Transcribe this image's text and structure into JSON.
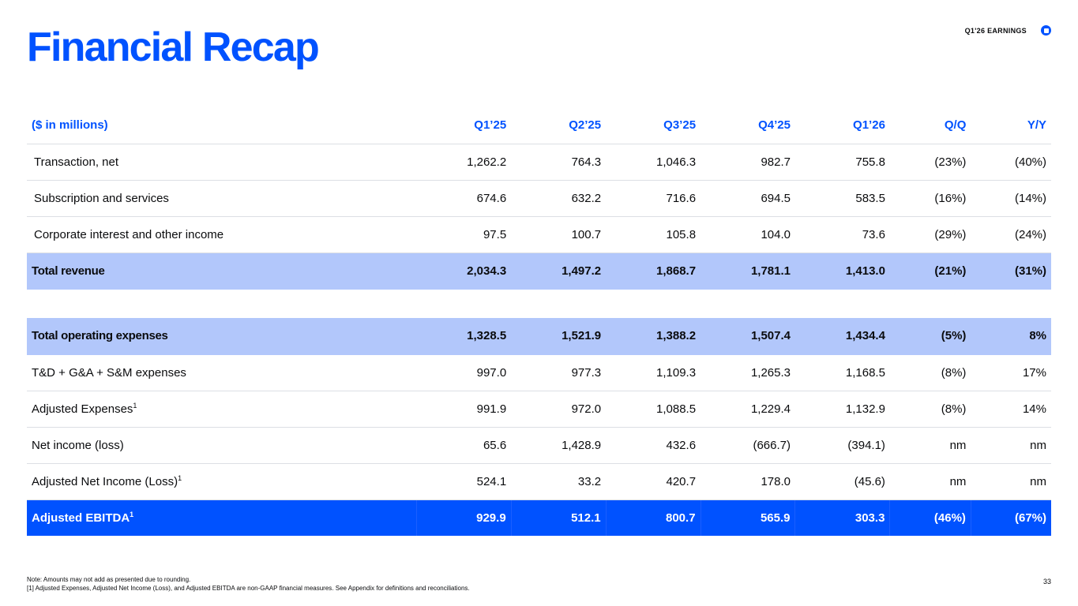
{
  "header": {
    "title": "Financial Recap",
    "earnings_label": "Q1'26 EARNINGS",
    "logo_icon": "coinbase-logo-icon",
    "accent_color": "#0052ff"
  },
  "table": {
    "columns": [
      "($ in millions)",
      "Q1’25",
      "Q2’25",
      "Q3’25",
      "Q4’25",
      "Q1’26",
      "Q/Q",
      "Y/Y"
    ],
    "revenue_rows": [
      {
        "label": "Transaction, net",
        "values": [
          "1,262.2",
          "764.3",
          "1,046.3",
          "982.7",
          "755.8",
          "(23%)",
          "(40%)"
        ]
      },
      {
        "label": "Subscription and services",
        "values": [
          "674.6",
          "632.2",
          "716.6",
          "694.5",
          "583.5",
          "(16%)",
          "(14%)"
        ]
      },
      {
        "label": "Corporate interest and other income",
        "values": [
          "97.5",
          "100.7",
          "105.8",
          "104.0",
          "73.6",
          "(29%)",
          "(24%)"
        ]
      }
    ],
    "total_revenue": {
      "label": "Total revenue",
      "values": [
        "2,034.3",
        "1,497.2",
        "1,868.7",
        "1,781.1",
        "1,413.0",
        "(21%)",
        "(31%)"
      ]
    },
    "total_opex": {
      "label": "Total operating expenses",
      "values": [
        "1,328.5",
        "1,521.9",
        "1,388.2",
        "1,507.4",
        "1,434.4",
        "(5%)",
        "8%"
      ]
    },
    "expense_rows": [
      {
        "label": "T&D + G&A + S&M expenses",
        "sup": "",
        "values": [
          "997.0",
          "977.3",
          "1,109.3",
          "1,265.3",
          "1,168.5",
          "(8%)",
          "17%"
        ]
      },
      {
        "label": "Adjusted Expenses",
        "sup": "1",
        "values": [
          "991.9",
          "972.0",
          "1,088.5",
          "1,229.4",
          "1,132.9",
          "(8%)",
          "14%"
        ]
      },
      {
        "label": "Net income (loss)",
        "sup": "",
        "values": [
          "65.6",
          "1,428.9",
          "432.6",
          "(666.7)",
          "(394.1)",
          "nm",
          "nm"
        ]
      },
      {
        "label": "Adjusted Net Income (Loss)",
        "sup": "1",
        "values": [
          "524.1",
          "33.2",
          "420.7",
          "178.0",
          "(45.6)",
          "nm",
          "nm"
        ]
      }
    ],
    "adjusted_ebitda": {
      "label": "Adjusted EBITDA",
      "sup": "1",
      "values": [
        "929.9",
        "512.1",
        "800.7",
        "565.9",
        "303.3",
        "(46%)",
        "(67%)"
      ]
    }
  },
  "footer": {
    "note_1": "Note: Amounts may not add as presented due to rounding.",
    "note_2": "[1] Adjusted Expenses, Adjusted Net Income (Loss), and Adjusted EBITDA are non-GAAP financial measures. See Appendix for definitions and reconciliations.",
    "page_number": "33"
  }
}
